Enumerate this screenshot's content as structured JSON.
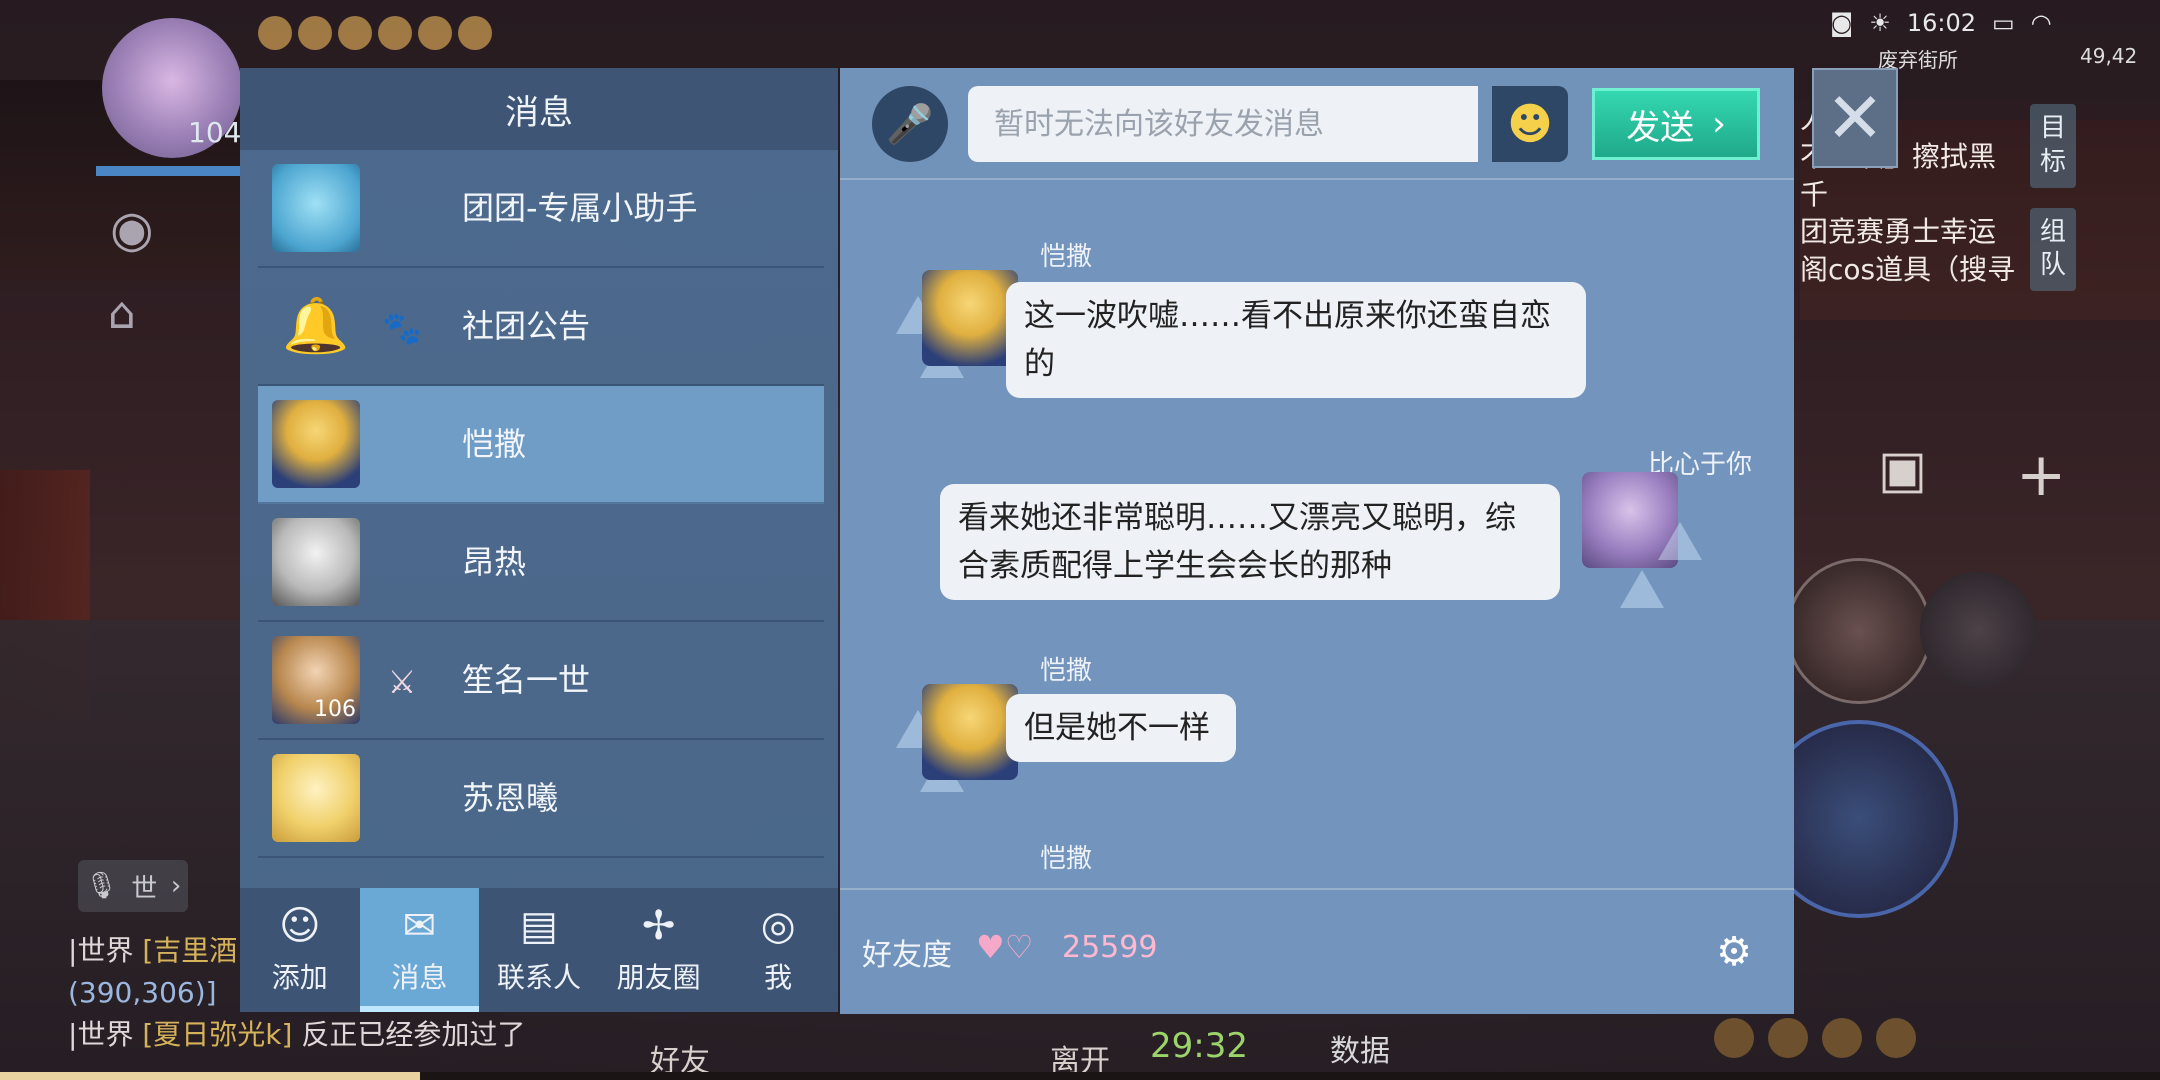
{
  "hud": {
    "player_level": "104",
    "time": "16:02",
    "map_name": "废弃街所",
    "coords": "49,42",
    "timer": "29:32",
    "data_label": "数据",
    "leave_label": "离开",
    "friends_label": "好友"
  },
  "right_chat": {
    "lines": [
      "人龙",
      "不思议】擦拭黑",
      "千",
      "团竞赛勇士幸运",
      "阁cos道具（搜寻"
    ],
    "tabs": [
      "目标",
      "组队"
    ]
  },
  "left_chat": {
    "line1_channel": "世界",
    "line1_name": "[吉里酒",
    "line2": "(390,306)]",
    "line3_channel": "世界",
    "line3_name": "[夏日弥光k]",
    "line3_text": "反正已经参加过了",
    "mic_label": "世"
  },
  "messages_panel": {
    "title": "消息",
    "contacts": [
      {
        "name": "团团-专属小助手",
        "level": "",
        "active": false
      },
      {
        "name": "社团公告",
        "level": "",
        "active": false
      },
      {
        "name": "恺撒",
        "level": "",
        "active": true
      },
      {
        "name": "昂热",
        "level": "",
        "active": false
      },
      {
        "name": "笙名一世",
        "level": "106",
        "active": false
      },
      {
        "name": "苏恩曦",
        "level": "",
        "active": false
      }
    ],
    "tabs": [
      {
        "label": "添加",
        "icon": "add-friend-icon"
      },
      {
        "label": "消息",
        "icon": "message-icon"
      },
      {
        "label": "联系人",
        "icon": "contacts-icon"
      },
      {
        "label": "朋友圈",
        "icon": "moments-icon"
      },
      {
        "label": "我",
        "icon": "me-icon"
      }
    ]
  },
  "chat": {
    "input_placeholder": "暂时无法向该好友发消息",
    "send_label": "发送",
    "messages": [
      {
        "sender": "恺撒",
        "text": "这一波吹嘘……看不出原来你还蛮自恋的",
        "side": "left"
      },
      {
        "sender": "比心于你",
        "text": "看来她还非常聪明……又漂亮又聪明，综合素质配得上学生会会长的那种",
        "side": "right"
      },
      {
        "sender": "恺撒",
        "text": "但是她不一样",
        "side": "left"
      },
      {
        "sender": "恺撒",
        "text": "",
        "side": "left"
      }
    ],
    "intimacy_label": "好友度",
    "intimacy_value": "25599"
  },
  "colors": {
    "panel_left": "#4d6a8e",
    "panel_right": "#7395bd",
    "active_contact": "#6f9dc6",
    "send_button": "#1fa88a",
    "intimacy_value": "#ffb8d0"
  }
}
